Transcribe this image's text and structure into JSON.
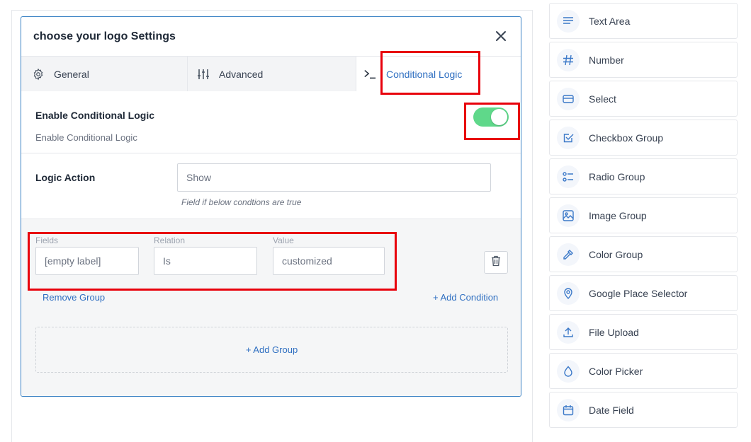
{
  "modal": {
    "title": "choose your logo Settings",
    "tabs": [
      {
        "label": "General",
        "icon": "gear-icon"
      },
      {
        "label": "Advanced",
        "icon": "sliders-icon"
      },
      {
        "label": "Conditional Logic",
        "icon": "terminal-icon",
        "active": true
      }
    ],
    "enable": {
      "title": "Enable Conditional Logic",
      "help": "Enable Conditional Logic",
      "toggle_on": true
    },
    "logic_action": {
      "label": "Logic Action",
      "value": "Show",
      "hint": "Field if below condtions are true"
    },
    "condition_group": {
      "fields_label": "Fields",
      "relation_label": "Relation",
      "value_label": "Value",
      "fields_value": "[empty label]",
      "relation_value": "Is",
      "value_value": "customized",
      "remove_group": "Remove Group",
      "add_condition": "+ Add Condition"
    },
    "add_group": "+ Add Group"
  },
  "colors": {
    "accent": "#2f6fc1",
    "toggle_on": "#5fd88a",
    "highlight": "#e8000b",
    "modal_border": "#3b82c4"
  },
  "field_types": [
    {
      "label": "Text Area",
      "icon": "text-area-icon"
    },
    {
      "label": "Number",
      "icon": "hash-icon"
    },
    {
      "label": "Select",
      "icon": "select-icon"
    },
    {
      "label": "Checkbox Group",
      "icon": "checkbox-icon"
    },
    {
      "label": "Radio Group",
      "icon": "radio-list-icon"
    },
    {
      "label": "Image Group",
      "icon": "image-icon"
    },
    {
      "label": "Color Group",
      "icon": "eyedropper-icon"
    },
    {
      "label": "Google Place Selector",
      "icon": "map-pin-icon"
    },
    {
      "label": "File Upload",
      "icon": "upload-icon"
    },
    {
      "label": "Color Picker",
      "icon": "droplet-icon"
    },
    {
      "label": "Date Field",
      "icon": "calendar-icon"
    }
  ]
}
